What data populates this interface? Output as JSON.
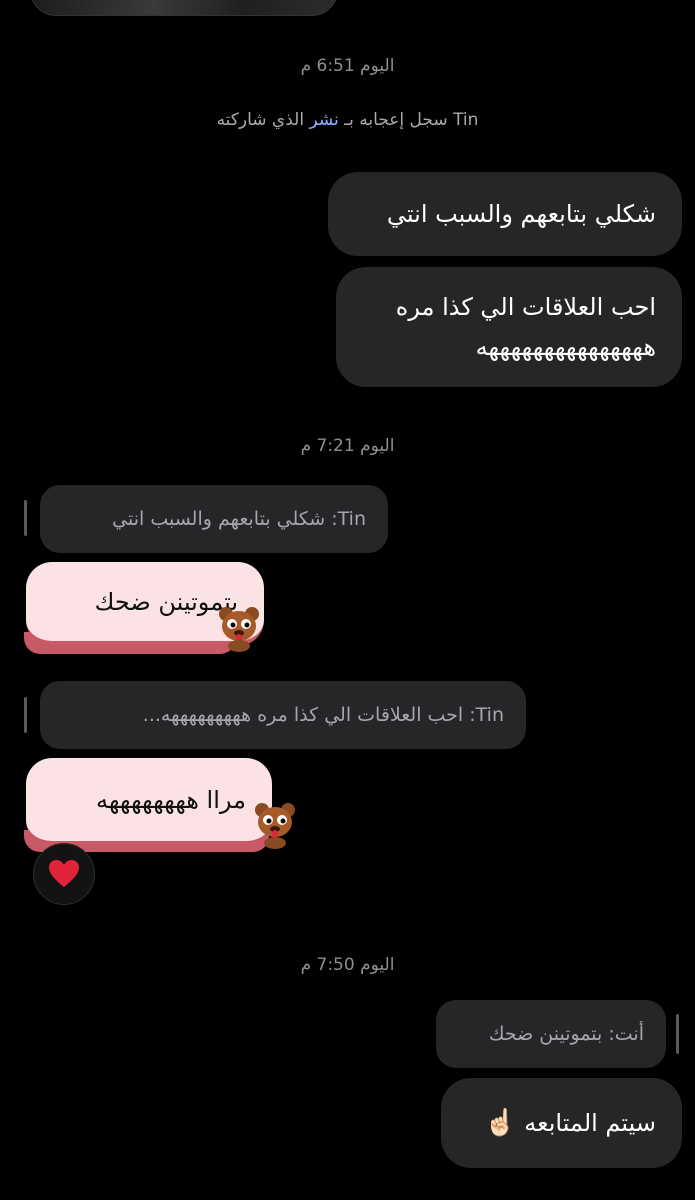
{
  "timestamps": {
    "t1": "اليوم 6:51 م",
    "t2": "اليوم 7:21 م",
    "t3": "اليوم 7:50 م"
  },
  "system_message": {
    "name": "Tin",
    "prefix": "سجل إعجابه بـ",
    "link": "نشر",
    "suffix": "الذي شاركته"
  },
  "messages": {
    "sent1": "شكلي بتابعهم والسبب انتي",
    "sent2_line1": "احب العلاقات الي كذا مره",
    "sent2_line2": "هههههههههههههههه",
    "quote1": "Tin: شكلي بتابعهم والسبب انتي",
    "reply1": "بتموتينن ضحك",
    "quote2": "Tin: احب العلاقات الي كذا مره هههههههههه...",
    "reply2": "مراا ههههههههه",
    "quote3": "أنت: بتموتينن ضحك",
    "sent3": "سيتم المتابعه",
    "sent3_emoji": "☝🏻"
  },
  "icons": {
    "sticker": "bear-sticker-icon",
    "reaction": "heart-icon"
  },
  "colors": {
    "background": "#000000",
    "bubble": "#262628",
    "pink_bubble": "#fbe2e5",
    "pink_tail": "#c85a67",
    "link": "#8fb4ff",
    "heart": "#e0243b"
  }
}
